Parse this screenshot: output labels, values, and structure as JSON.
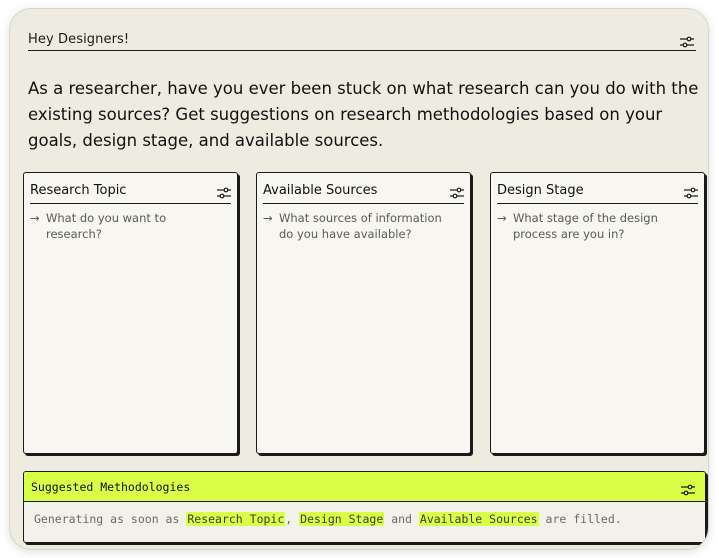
{
  "header": {
    "title": "Hey Designers!",
    "icon": "sliders-icon"
  },
  "intro": "As a researcher, have you ever been stuck on what research can you do with the existing sources? Get suggestions on research methodologies based on your goals, design stage, and available sources.",
  "cards": [
    {
      "title": "Research Topic",
      "arrow": "→",
      "prompt": "What do you want to research?"
    },
    {
      "title": "Available Sources",
      "arrow": "→",
      "prompt": "What sources of information do you have available?"
    },
    {
      "title": "Design Stage",
      "arrow": "→",
      "prompt": "What stage of the design process are you in?"
    }
  ],
  "suggestions": {
    "title": "Suggested Methodologies",
    "text_before": "Generating as soon as",
    "chip1": "Research Topic",
    "sep1": ",",
    "chip2": "Design Stage",
    "sep2": "and",
    "chip3": "Available Sources",
    "text_after": "are filled."
  },
  "colors": {
    "background": "#eeece1",
    "accent": "#d9ff47",
    "card": "#f7f6f0",
    "ink": "#1a1a1a"
  }
}
